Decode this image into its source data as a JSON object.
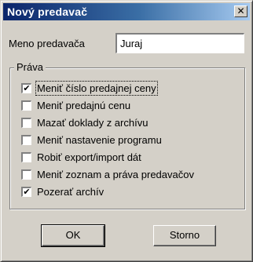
{
  "window": {
    "title": "Nový predavač",
    "close_glyph": "✕"
  },
  "name_field": {
    "label": "Meno predavača",
    "value": "Juraj"
  },
  "rights": {
    "legend": "Práva",
    "items": [
      {
        "label": "Meniť číslo predajnej ceny",
        "checked": true
      },
      {
        "label": "Meniť predajnú cenu",
        "checked": false
      },
      {
        "label": "Mazať doklady z archívu",
        "checked": false
      },
      {
        "label": "Meniť nastavenie programu",
        "checked": false
      },
      {
        "label": "Robiť export/import dát",
        "checked": false
      },
      {
        "label": "Meniť zoznam a práva predavačov",
        "checked": false
      },
      {
        "label": "Pozerať archív",
        "checked": true
      }
    ]
  },
  "buttons": {
    "ok": "OK",
    "cancel": "Storno"
  },
  "colors": {
    "title_start": "#0a246a",
    "title_end": "#a6caf0",
    "face": "#d4d0c8"
  },
  "icons": {
    "close": "close-icon",
    "check": "checkmark-icon"
  }
}
